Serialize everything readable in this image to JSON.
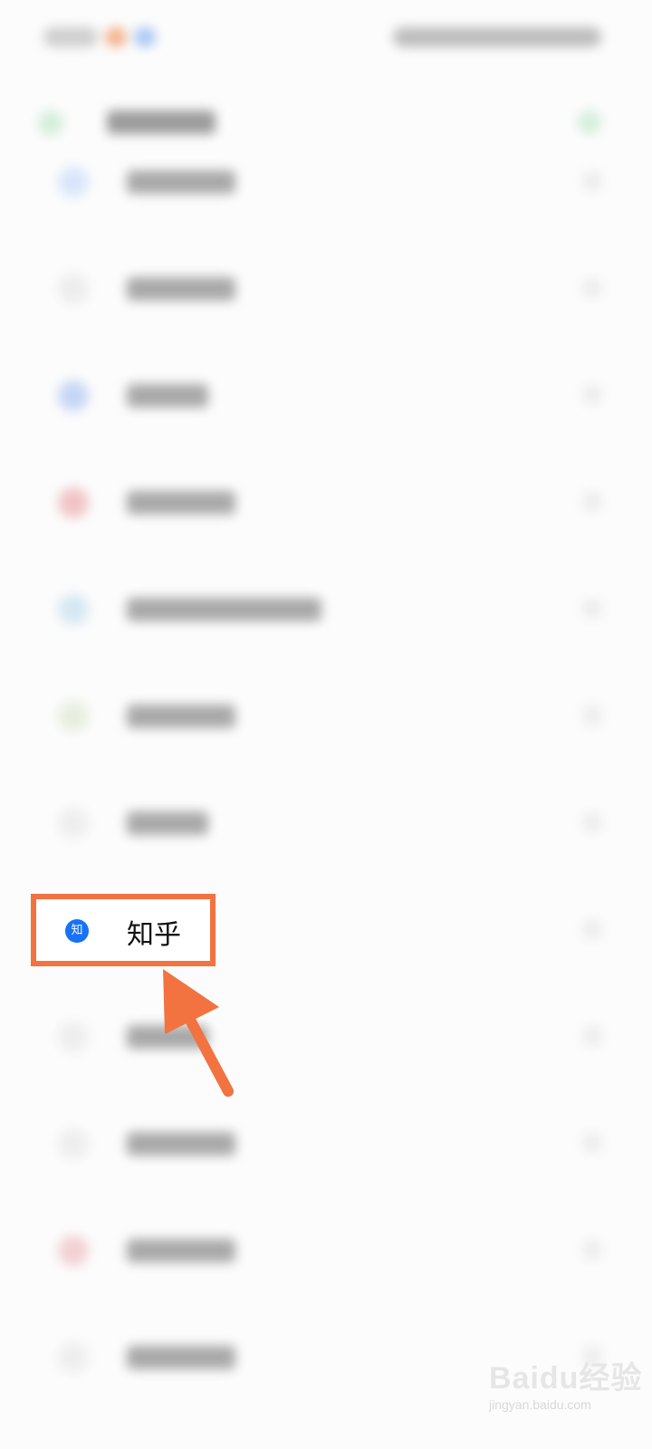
{
  "highlighted_app": {
    "icon_glyph": "知",
    "label": "知乎"
  },
  "colors": {
    "highlight": "#f27240",
    "zhihu_blue": "#1772f6"
  },
  "watermark": {
    "logo": "Baidu经验",
    "url": "jingyan.baidu.com"
  },
  "icons": {
    "pointer": "arrow-icon"
  }
}
